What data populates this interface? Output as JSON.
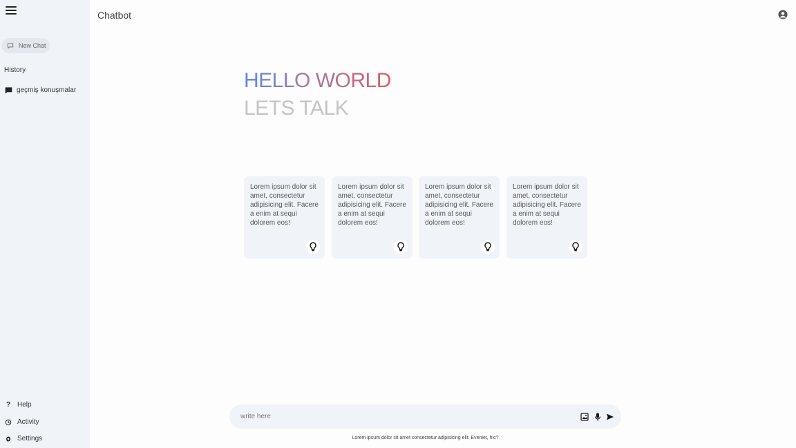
{
  "header": {
    "title": "Chatbot"
  },
  "sidebar": {
    "new_chat_label": "New Chat",
    "history_title": "History",
    "history_items": [
      {
        "label": "geçmiş konuşmalar"
      }
    ],
    "bottom_items": [
      {
        "label": "Help",
        "icon": "question-icon"
      },
      {
        "label": "Activity",
        "icon": "history-icon"
      },
      {
        "label": "Settings",
        "icon": "gear-icon"
      }
    ]
  },
  "greeting": {
    "line1": "HELLO WORLD",
    "line2": "LETS TALK",
    "gradient": [
      "#5a87e8",
      "#a57aa6",
      "#e05a60"
    ],
    "muted_color": "#c4c4c4"
  },
  "cards": [
    {
      "text": "Lorem ipsum dolor sit amet, consectetur adipisicing elit. Facere a enim at sequi dolorem eos!",
      "icon": "lightbulb-icon"
    },
    {
      "text": "Lorem ipsum dolor sit amet, consectetur adipisicing elit. Facere a enim at sequi dolorem eos!",
      "icon": "lightbulb-icon"
    },
    {
      "text": "Lorem ipsum dolor sit amet, consectetur adipisicing elit. Facere a enim at sequi dolorem eos!",
      "icon": "lightbulb-icon"
    },
    {
      "text": "Lorem ipsum dolor sit amet, consectetur adipisicing elit. Facere a enim at sequi dolorem eos!",
      "icon": "lightbulb-icon"
    }
  ],
  "prompt": {
    "placeholder": "write here",
    "value": "",
    "footer_note": "Lorem ipsum dolor sit amet consectetur adipisicing elit. Eveniet, hic?"
  },
  "colors": {
    "sidebar_bg": "#f0f3f8",
    "card_bg": "#f0f3f8",
    "page_bg": "#fdfdfd"
  }
}
